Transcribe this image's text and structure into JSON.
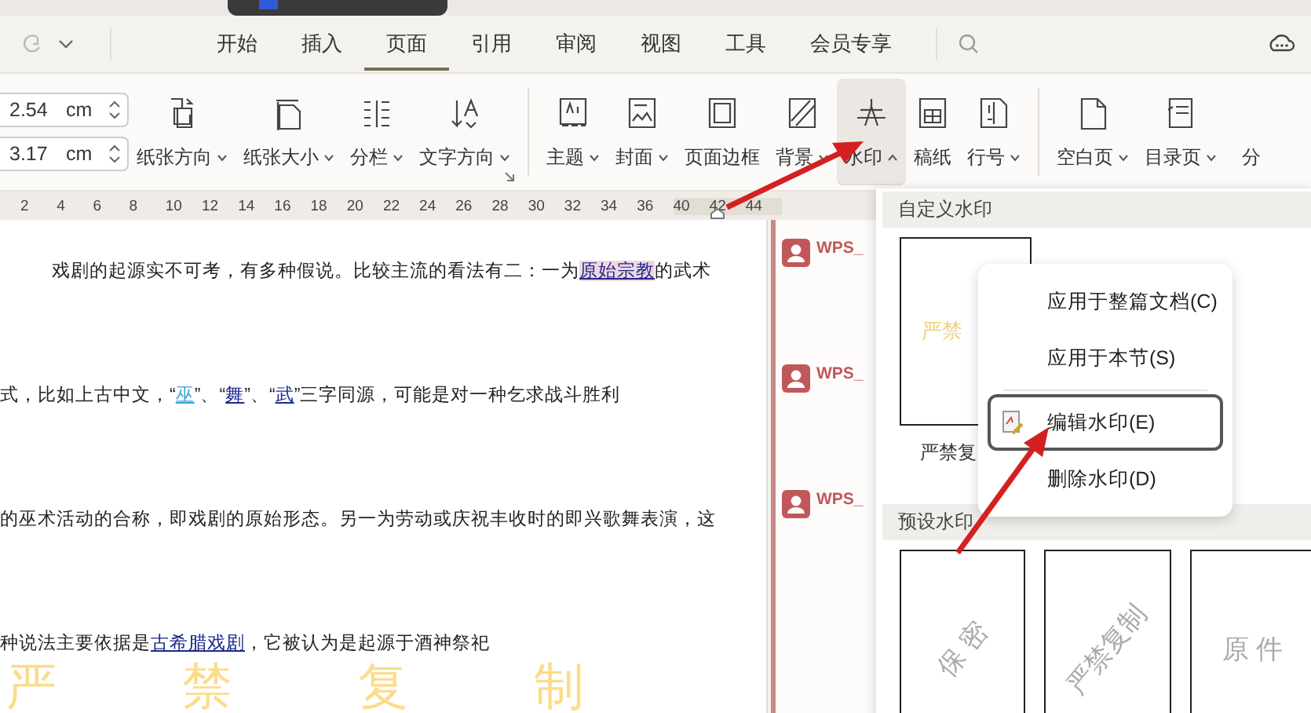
{
  "tabs": [
    {
      "label": "开始",
      "selected": false
    },
    {
      "label": "插入",
      "selected": false
    },
    {
      "label": "页面",
      "selected": true
    },
    {
      "label": "引用",
      "selected": false
    },
    {
      "label": "审阅",
      "selected": false
    },
    {
      "label": "视图",
      "selected": false
    },
    {
      "label": "工具",
      "selected": false
    },
    {
      "label": "会员专享",
      "selected": false
    }
  ],
  "margins": [
    {
      "value": "2.54",
      "unit": "cm"
    },
    {
      "value": "3.17",
      "unit": "cm"
    }
  ],
  "ribbon_groups": [
    {
      "buttons": [
        {
          "label": "纸张方向",
          "dropdown": true,
          "expanded": false,
          "selected": false
        },
        {
          "label": "纸张大小",
          "dropdown": true,
          "expanded": false,
          "selected": false
        },
        {
          "label": "分栏",
          "dropdown": true,
          "expanded": false,
          "selected": false
        },
        {
          "label": "文字方向",
          "dropdown": true,
          "expanded": false,
          "selected": false
        }
      ]
    },
    {
      "buttons": [
        {
          "label": "主题",
          "dropdown": true,
          "expanded": false,
          "selected": false
        },
        {
          "label": "封面",
          "dropdown": true,
          "expanded": false,
          "selected": false
        },
        {
          "label": "页面边框",
          "dropdown": false,
          "expanded": false,
          "selected": false
        },
        {
          "label": "背景",
          "dropdown": true,
          "expanded": false,
          "selected": false
        },
        {
          "label": "水印",
          "dropdown": true,
          "expanded": true,
          "selected": true
        },
        {
          "label": "稿纸",
          "dropdown": false,
          "expanded": false,
          "selected": false
        },
        {
          "label": "行号",
          "dropdown": true,
          "expanded": false,
          "selected": false
        }
      ]
    },
    {
      "buttons": [
        {
          "label": "空白页",
          "dropdown": true,
          "expanded": false,
          "selected": false
        },
        {
          "label": "目录页",
          "dropdown": true,
          "expanded": false,
          "selected": false
        },
        {
          "label": "分",
          "dropdown": false,
          "expanded": false,
          "selected": false
        }
      ]
    }
  ],
  "ruler": [
    "2",
    "4",
    "6",
    "8",
    "10",
    "12",
    "14",
    "16",
    "18",
    "20",
    "22",
    "24",
    "26",
    "28",
    "30",
    "32",
    "34",
    "36",
    "40",
    "42",
    "44"
  ],
  "document": {
    "lines": [
      [
        {
          "kind": "text",
          "text": "戏剧的起源实不可考，有多种假说。比较主流的看法有二：一为"
        },
        {
          "kind": "marked-link",
          "text": "原始宗教"
        },
        {
          "kind": "text",
          "text": "的武术"
        }
      ],
      [
        {
          "kind": "text",
          "text": "式，比如上古中文，“"
        },
        {
          "kind": "light-link",
          "text": "巫"
        },
        {
          "kind": "text",
          "text": "”、“"
        },
        {
          "kind": "link",
          "text": "舞"
        },
        {
          "kind": "text",
          "text": "”、“"
        },
        {
          "kind": "link",
          "text": "武"
        },
        {
          "kind": "text",
          "text": "”三字同源，可能是对一种乞求战斗胜利"
        }
      ],
      [
        {
          "kind": "text",
          "text": "的巫术活动的合称，即戏剧的原始形态。另一为劳动或庆祝丰收时的即兴歌舞表演，这"
        }
      ],
      [
        {
          "kind": "text",
          "text": "种说法主要依据是"
        },
        {
          "kind": "link",
          "text": "古希腊戏剧"
        },
        {
          "kind": "text",
          "text": "，它被认为是起源于酒神祭祀"
        }
      ]
    ],
    "watermark": "严禁复制"
  },
  "comments": [
    {
      "author": "WPS_"
    },
    {
      "author": "WPS_"
    },
    {
      "author": "WPS_"
    }
  ],
  "watermark_panel": {
    "custom_header": "自定义水印",
    "custom_items": [
      {
        "preview": "严禁",
        "label": "严禁复"
      }
    ],
    "preset_header": "预设水印",
    "preset_items": [
      {
        "preview": "保 密",
        "kind": "rotated"
      },
      {
        "preview": "严禁复制",
        "kind": "rotated"
      },
      {
        "preview": "原 件",
        "kind": "flat"
      }
    ]
  },
  "context_menu": [
    {
      "label": "应用于整篇文档(C)",
      "selected": false,
      "icon": false
    },
    {
      "label": "应用于本节(S)",
      "selected": false,
      "icon": false
    },
    {
      "label": "编辑水印(E)",
      "selected": true,
      "icon": true
    },
    {
      "label": "删除水印(D)",
      "selected": false,
      "icon": false
    }
  ]
}
